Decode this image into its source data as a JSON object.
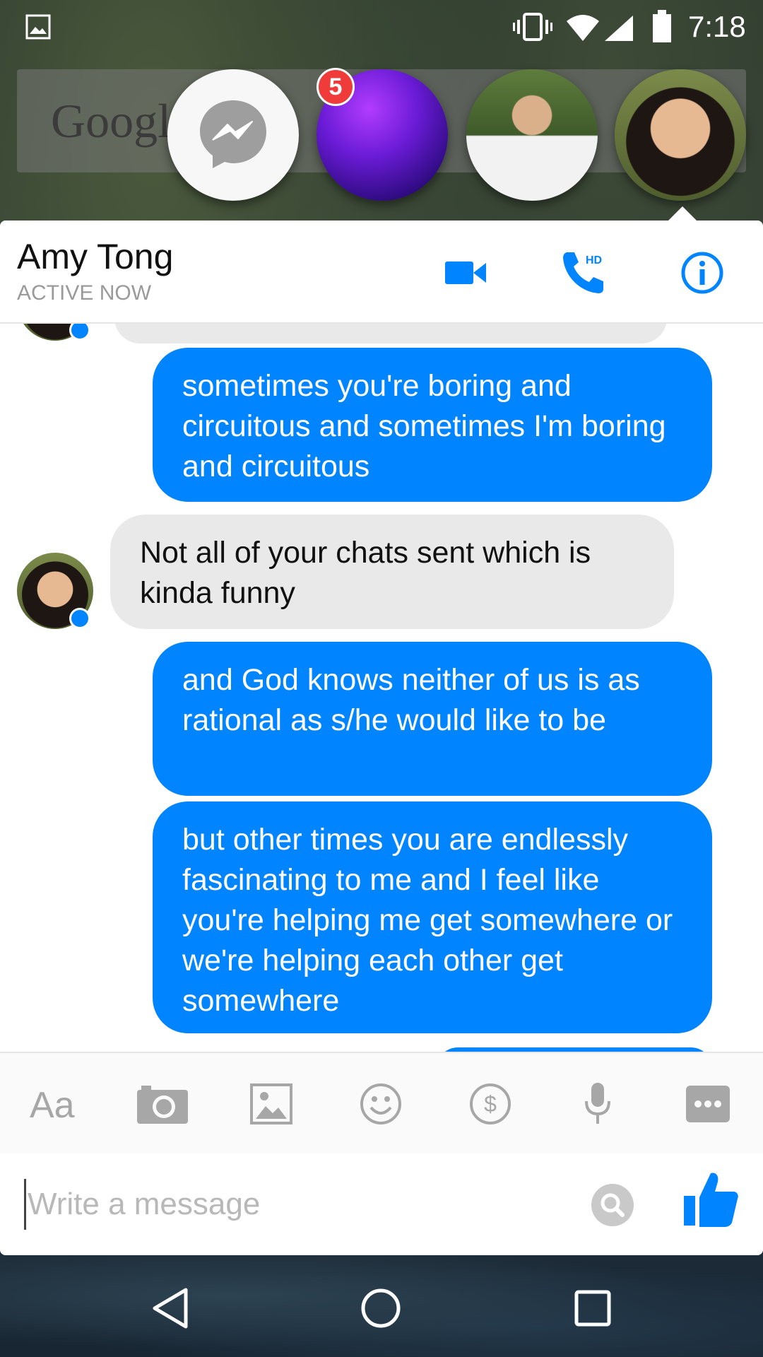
{
  "status_bar": {
    "time": "7:18"
  },
  "background": {
    "google_label": "Google"
  },
  "chat_heads": {
    "badge_count": "5"
  },
  "header": {
    "contact_name": "Amy Tong",
    "status": "ACTIVE NOW",
    "call_label": "HD"
  },
  "messages": [
    {
      "direction": "out",
      "text": "sometimes you're boring and circuitous and sometimes I'm boring and circuitous"
    },
    {
      "direction": "in",
      "text": "Not all of your chats sent which is kinda funny"
    },
    {
      "direction": "out",
      "text": "and God knows neither of us is as rational as s/he would like to be"
    },
    {
      "direction": "out",
      "text": "but other times you are endlessly fascinating to me and I feel like you're helping me get somewhere or we're helping each other get somewhere"
    }
  ],
  "toolbar": {
    "text_label": "Aa"
  },
  "composer": {
    "placeholder": "Write a message",
    "value": ""
  },
  "colors": {
    "accent": "#0084ff",
    "incoming_bubble": "#e9e9e9",
    "badge": "#f03b3b"
  },
  "icons": [
    "gallery-icon",
    "vibrate-icon",
    "wifi-icon",
    "signal-icon",
    "battery-icon",
    "messenger-icon",
    "video-icon",
    "phone-icon",
    "info-icon",
    "camera-icon",
    "image-icon",
    "emoji-icon",
    "payment-icon",
    "microphone-icon",
    "more-icon",
    "search-icon",
    "thumbs-up-icon",
    "back-icon",
    "home-icon",
    "recents-icon"
  ]
}
